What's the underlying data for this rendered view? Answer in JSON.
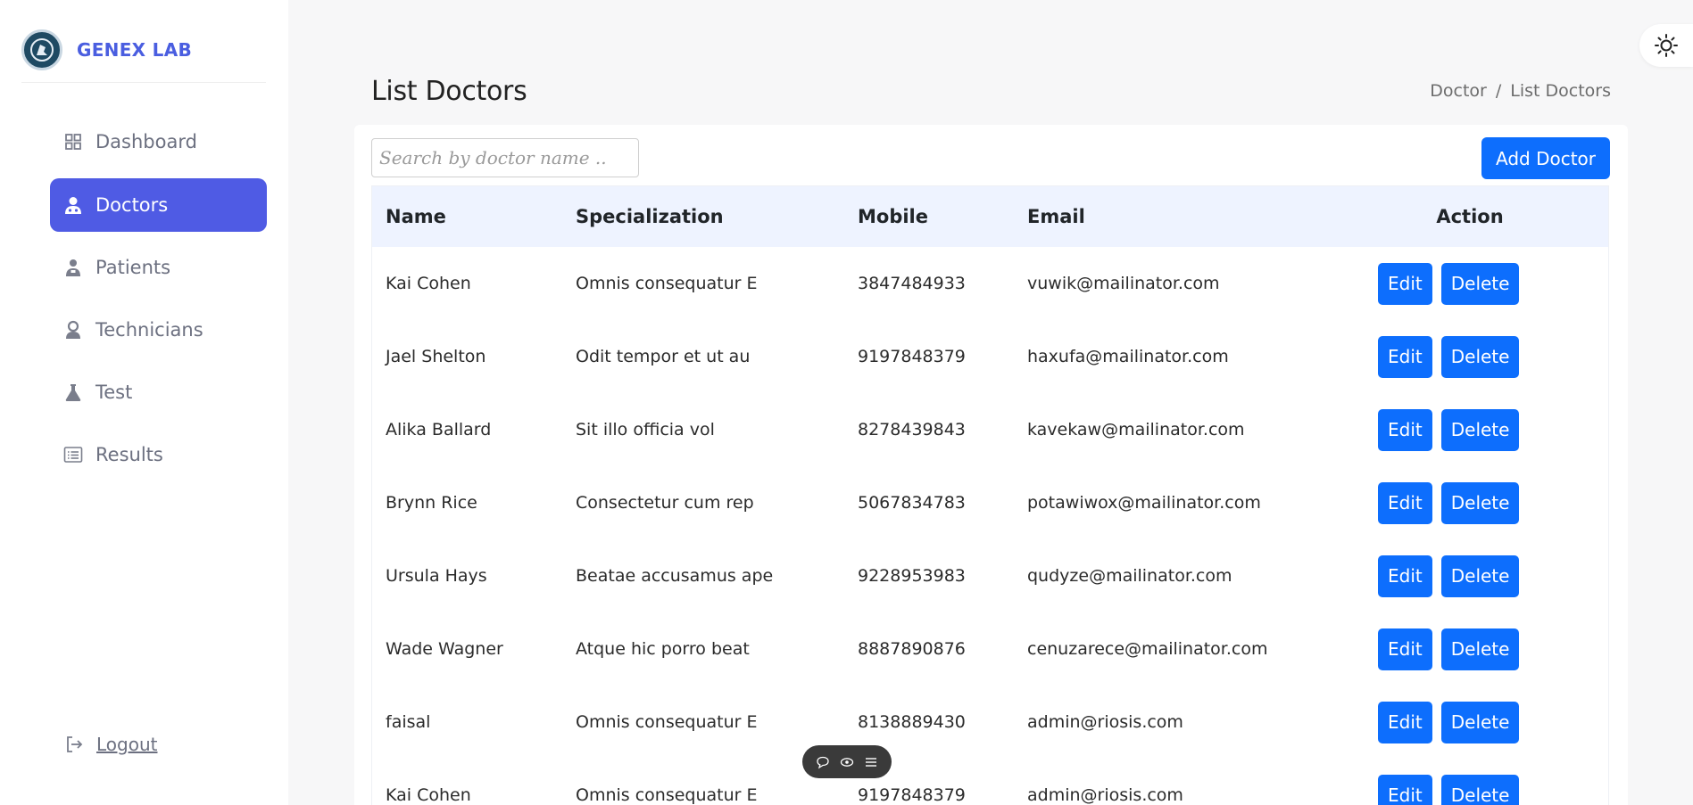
{
  "brand": {
    "name": "GENEX LAB"
  },
  "sidebar": {
    "items": [
      {
        "label": "Dashboard",
        "icon": "grid-icon"
      },
      {
        "label": "Doctors",
        "icon": "doctor-icon",
        "active": true
      },
      {
        "label": "Patients",
        "icon": "patient-icon"
      },
      {
        "label": "Technicians",
        "icon": "technician-icon"
      },
      {
        "label": "Test",
        "icon": "flask-icon"
      },
      {
        "label": "Results",
        "icon": "list-icon"
      }
    ],
    "logout": "Logout"
  },
  "header": {
    "title": "List Doctors",
    "breadcrumb": {
      "parent": "Doctor",
      "separator": "/",
      "current": "List Doctors"
    }
  },
  "search": {
    "placeholder": "Search by doctor name ..",
    "value": ""
  },
  "add_button": "Add Doctor",
  "table": {
    "columns": {
      "name": "Name",
      "specialization": "Specialization",
      "mobile": "Mobile",
      "email": "Email",
      "action": "Action"
    },
    "edit_label": "Edit",
    "delete_label": "Delete",
    "rows": [
      {
        "name": "Kai Cohen",
        "specialization": "Omnis consequatur E",
        "mobile": "3847484933",
        "email": "vuwik@mailinator.com"
      },
      {
        "name": "Jael Shelton",
        "specialization": "Odit tempor et ut au",
        "mobile": "9197848379",
        "email": "haxufa@mailinator.com"
      },
      {
        "name": "Alika Ballard",
        "specialization": "Sit illo officia vol",
        "mobile": "8278439843",
        "email": "kavekaw@mailinator.com"
      },
      {
        "name": "Brynn Rice",
        "specialization": "Consectetur cum rep",
        "mobile": "5067834783",
        "email": "potawiwox@mailinator.com"
      },
      {
        "name": "Ursula Hays",
        "specialization": "Beatae accusamus ape",
        "mobile": "9228953983",
        "email": "qudyze@mailinator.com"
      },
      {
        "name": "Wade Wagner",
        "specialization": "Atque hic porro beat",
        "mobile": "8887890876",
        "email": "cenuzarece@mailinator.com"
      },
      {
        "name": "faisal",
        "specialization": "Omnis consequatur E",
        "mobile": "8138889430",
        "email": "admin@riosis.com"
      },
      {
        "name": "Kai Cohen",
        "specialization": "Omnis consequatur E",
        "mobile": "9197848379",
        "email": "admin@riosis.com"
      }
    ]
  },
  "colors": {
    "accent": "#4f5be4",
    "primary_button": "#0d6efd",
    "table_header_bg": "#eef3ff"
  }
}
